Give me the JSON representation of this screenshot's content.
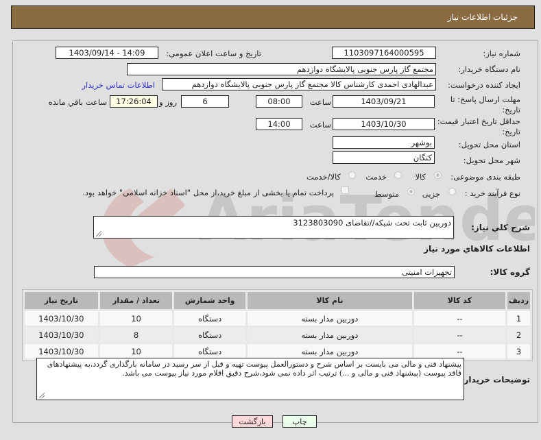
{
  "header": {
    "title": "جزئیات اطلاعات نیاز"
  },
  "fields": {
    "need_number": {
      "label": "شماره نیاز:",
      "value": "1103097164000595"
    },
    "announce_datetime": {
      "label": "تاریخ و ساعت اعلان عمومی:",
      "value": "1403/09/14 - 14:09"
    },
    "buyer_org": {
      "label": "نام دستگاه خریدار:",
      "value": "مجتمع گاز پارس جنوبی  پالایشگاه دوازدهم"
    },
    "requester": {
      "label": "ایجاد کننده درخواست:",
      "value": "عبدالهادی احمدی کارشناس کالا مجتمع گاز پارس جنوبی  پالایشگاه دوازدهم"
    },
    "buyer_contact_link": "اطلاعات تماس خریدار",
    "response_deadline": {
      "label": "مهلت ارسال پاسخ: تا تاریخ:",
      "date": "1403/09/21",
      "time_label": "ساعت",
      "time": "08:00",
      "days": "6",
      "days_label": "روز و",
      "remaining_time": "17:26:04",
      "remaining_label": "ساعت باقي مانده"
    },
    "price_validity": {
      "label": "حداقل تاریخ اعتبار قیمت: تا تاریخ:",
      "date": "1403/10/30",
      "time_label": "ساعت",
      "time": "14:00"
    },
    "delivery_province": {
      "label": "استان محل تحویل:",
      "value": "بوشهر"
    },
    "delivery_city": {
      "label": "شهر محل تحویل:",
      "value": "کنگان"
    },
    "subject_category": {
      "label": "طبقه بندی موضوعی:",
      "options": [
        "کالا",
        "خدمت",
        "کالا/خدمت"
      ],
      "selected": "کالا"
    },
    "purchase_process": {
      "label": "نوع فرآیند خرید :",
      "options": [
        "جزیی",
        "متوسط"
      ],
      "selected": "متوسط",
      "treasury_checkbox_label": "پرداخت تمام یا بخشی از مبلغ خرید،از محل \"اسناد خزانه اسلامی\" خواهد بود.",
      "treasury_checked": false
    },
    "general_description": {
      "label": "شرح کلي نياز:",
      "value": "دوربین ثابت تحت شبکه//تقاضای 3123803090"
    }
  },
  "items_section": {
    "title": "اطلاعات کالاهاي مورد نياز",
    "goods_group": {
      "label": "گروه کالا:",
      "value": "تجهیزات امنیتی"
    },
    "table": {
      "columns": [
        "ردیف",
        "کد کالا",
        "نام کالا",
        "واحد شمارش",
        "تعداد / مقدار",
        "تاریخ نیاز"
      ],
      "rows": [
        {
          "row": "1",
          "code": "--",
          "name": "دوربین مدار بسته",
          "unit": "دستگاه",
          "qty": "10",
          "date": "1403/10/30"
        },
        {
          "row": "2",
          "code": "--",
          "name": "دوربین مدار بسته",
          "unit": "دستگاه",
          "qty": "8",
          "date": "1403/10/30"
        },
        {
          "row": "3",
          "code": "--",
          "name": "دوربین مدار بسته",
          "unit": "دستگاه",
          "qty": "10",
          "date": "1403/10/30"
        }
      ]
    }
  },
  "buyer_notes": {
    "label": "توضیحات خریدار:",
    "value": "پیشنهاد فنی و مالی می بایست بر اساس شرح و دستورالعمل پیوست تهیه و قبل از سر رسید در سامانه بارگذاری گردد،به پیشنهادهای فاقد پیوست (پیشنهاد فنی و مالی و ...) ترتیب اثر داده نمی شود،شرح دقیق اقلام مورد نیاز پیوست می باشد."
  },
  "buttons": {
    "print": "چاپ",
    "back": "بازگشت"
  },
  "colors": {
    "header_bg": "#8b6c42",
    "print_bg": "#eaffea",
    "back_bg": "#ffd9d9",
    "link": "#2a2ad0"
  },
  "watermark": "AriaTender.neT"
}
